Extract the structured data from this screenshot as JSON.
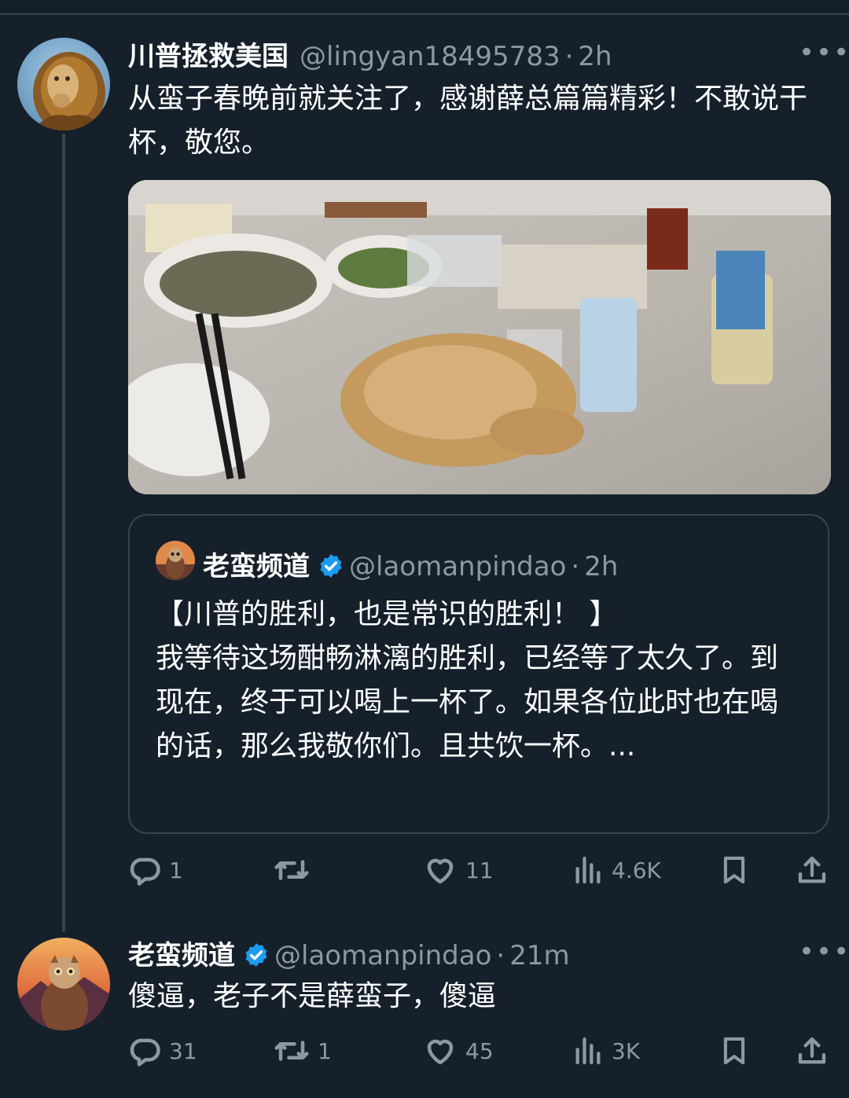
{
  "tweet1": {
    "name": "川普拯救美国",
    "handle": "@lingyan18495783",
    "sep": "·",
    "time": "2h",
    "text": "从蛮子春晚前就关注了，感谢薛总篇篇精彩！不敢说干杯，敬您。",
    "stats": {
      "replies": "1",
      "retweets": "",
      "likes": "11",
      "views": "4.6K"
    }
  },
  "quote": {
    "name": "老蛮频道",
    "handle": "@laomanpindao",
    "sep": "·",
    "time": "2h",
    "text": "【川普的胜利，也是常识的胜利！ 】\n我等待这场酣畅淋漓的胜利，已经等了太久了。到现在，终于可以喝上一杯了。如果各位此时也在喝的话，那么我敬你们。且共饮一杯。..."
  },
  "tweet2": {
    "name": "老蛮频道",
    "handle": "@laomanpindao",
    "sep": "·",
    "time": "21m",
    "text": "傻逼，老子不是薛蛮子，傻逼",
    "stats": {
      "replies": "31",
      "retweets": "1",
      "likes": "45",
      "views": "3K"
    }
  },
  "icons": [
    "more-icon",
    "reply-icon",
    "retweet-icon",
    "like-icon",
    "views-icon",
    "bookmark-icon",
    "share-icon",
    "verified-badge-icon"
  ],
  "colors": {
    "background": "#15202b",
    "secondary_text": "#8b98a5",
    "border": "#38444d",
    "verified": "#1d9bf0"
  }
}
